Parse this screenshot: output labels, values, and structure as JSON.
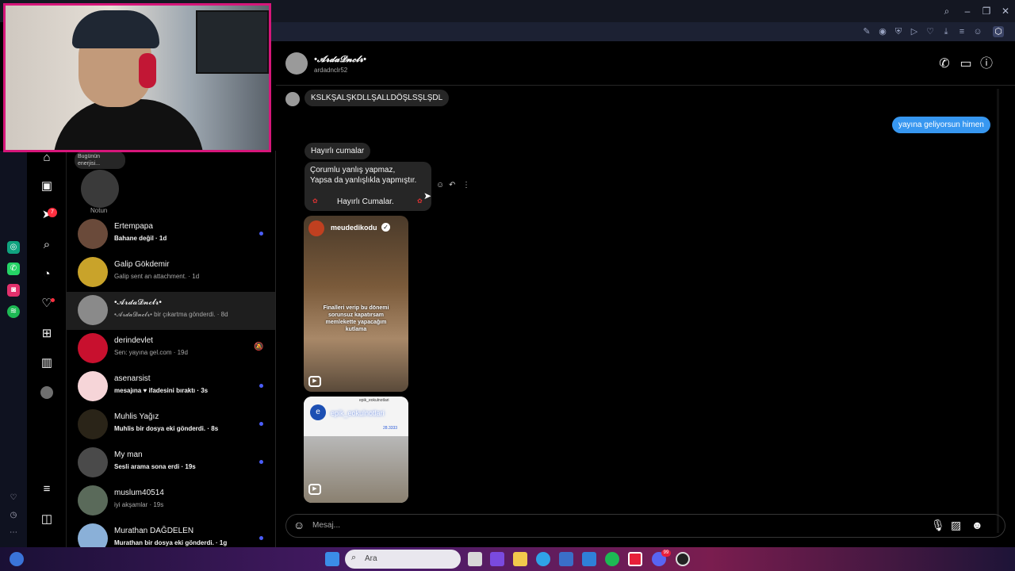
{
  "browser": {
    "tab_icons": [
      "edit-icon",
      "camera-icon",
      "shield-icon",
      "play-icon",
      "heart-icon",
      "download-icon",
      "menu-icon",
      "user-icon",
      "extension-icon"
    ],
    "window_controls": [
      "search-icon",
      "minimize-icon",
      "restore-icon",
      "close-icon"
    ]
  },
  "rail": {
    "apps": [
      {
        "name": "chatgpt-icon",
        "color": "#10a37f"
      },
      {
        "name": "whatsapp-icon",
        "color": "#25d366"
      },
      {
        "name": "instagram-icon",
        "color": "#e1306c"
      },
      {
        "name": "spotify-icon",
        "color": "#1db954"
      }
    ]
  },
  "nav": {
    "badge_count": "7",
    "items": [
      "home-icon",
      "reels-icon",
      "messages-icon",
      "search-icon",
      "explore-icon",
      "notifications-icon",
      "create-icon",
      "dashboard-icon",
      "profile-icon",
      "menu-icon",
      "apps-icon"
    ]
  },
  "notes": {
    "bubble_text": "Bugünün enerjisi...",
    "label": "Notun"
  },
  "conversations": [
    {
      "name": "Ertempapa",
      "sub": "Bahane değil · 1d",
      "unread": true,
      "color": "#6a4a3a"
    },
    {
      "name": "Galip Gökdemir",
      "sub": "Galip sent an attachment. · 1d",
      "unread": false,
      "color": "#c9a32a"
    },
    {
      "name": "•𝓐𝓻𝓭𝓪𝓓𝓷𝓬𝓵𝓻•",
      "sub": "•𝓐𝓻𝓭𝓪𝓓𝓷𝓬𝓵𝓻• bir çıkartma gönderdi. · 8d",
      "unread": false,
      "active": true,
      "color": "#8a8a8a"
    },
    {
      "name": "derindevlet",
      "sub": "Sen: yayına gel.com · 19d",
      "unread": false,
      "muted": true,
      "color": "#c8102e"
    },
    {
      "name": "asenarsist",
      "sub": "mesajına ♥ ifadesini bıraktı · 3s",
      "unread": true,
      "color": "#f6d5d8"
    },
    {
      "name": "Muhlis Yağız",
      "sub": "Muhlis bir dosya eki gönderdi. · 8s",
      "unread": true,
      "color": "#2a2418"
    },
    {
      "name": "My man",
      "sub": "Sesli arama sona erdi · 19s",
      "unread": true,
      "color": "#4a4a4a"
    },
    {
      "name": "muslum40514",
      "sub": "iyi akşamlar · 19s",
      "unread": false,
      "color": "#5a6a5a"
    },
    {
      "name": "Murathan DAĞDELEN",
      "sub": "Murathan bir dosya eki gönderdi. · 1g",
      "unread": true,
      "color": "#8ab0d8"
    }
  ],
  "chat": {
    "name": "•𝓐𝓻𝓭𝓪𝓓𝓷𝓬𝓵𝓻•",
    "username": "ardadnclr52",
    "messages": {
      "m1": "KSLKŞALŞKDLLŞALLDÖŞLSŞLŞDL",
      "m2": "yayına geliyorsun himen",
      "m3": "Hayırlı cumalar",
      "m4_line1": "Çorumlu yanlış yapmaz,",
      "m4_line2": "Yapsa da yanlışlıkla yapmıştır.",
      "m4_line3": "Hayırlı Cumalar."
    },
    "reel1": {
      "account": "meudedikodu",
      "caption": "Finalleri verip bu dönemi sorunsuz kapatırsam memlekette yapacağım kutlama"
    },
    "reel2": {
      "account": "epik_eokulnotlari",
      "overlay": "epik_eokulnotlari",
      "score": "28.3333"
    },
    "composer_placeholder": "Mesaj..."
  },
  "taskbar": {
    "search_label": "Ara",
    "discord_badge": "99"
  }
}
